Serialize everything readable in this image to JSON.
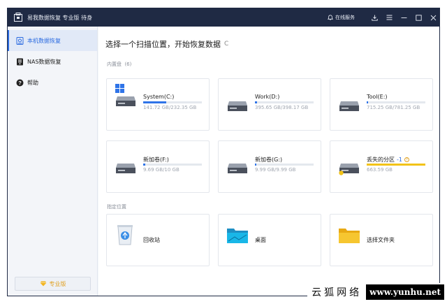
{
  "app": {
    "title": "易我数据恢复 专业版 待身",
    "online_service": "在线服务"
  },
  "sidebar": {
    "items": [
      {
        "label": "本机数据恢复",
        "icon": "computer-recovery-icon",
        "active": true
      },
      {
        "label": "NAS数据恢复",
        "icon": "nas-icon",
        "active": false
      },
      {
        "label": "帮助",
        "icon": "help-icon",
        "active": false
      }
    ],
    "pro_label": "专业版"
  },
  "main": {
    "heading": "选择一个扫描位置，开始恢复数据",
    "refresh_symbol": "C",
    "internal_label": "内置盘",
    "internal_count": "(6)",
    "drives": [
      {
        "name": "System(C:)",
        "size": "141.72 GB/232.35 GB",
        "used_fraction": 0.39,
        "icon": "windows-drive-icon"
      },
      {
        "name": "Work(D:)",
        "size": "395.65 GB/398.17 GB",
        "used_fraction": 0.02,
        "icon": "drive-icon"
      },
      {
        "name": "Tool(E:)",
        "size": "715.25 GB/781.25 GB",
        "used_fraction": 0.01,
        "icon": "drive-icon"
      },
      {
        "name": "新加卷(F:)",
        "size": "9.69 GB/10 GB",
        "used_fraction": 0.03,
        "icon": "drive-icon"
      },
      {
        "name": "新加卷(G:)",
        "size": "9.99 GB/9.99 GB",
        "used_fraction": 0.01,
        "icon": "drive-icon"
      },
      {
        "name": "丢失的分区",
        "extra": "-1",
        "size": "663.59 GB",
        "used_fraction": 1.0,
        "icon": "lost-drive-icon"
      }
    ],
    "location_label": "指定位置",
    "locations": [
      {
        "name": "回收站",
        "icon": "recycle-bin-icon"
      },
      {
        "name": "桌面",
        "icon": "desktop-icon"
      },
      {
        "name": "选择文件夹",
        "icon": "folder-icon"
      }
    ]
  },
  "watermark": {
    "cn": "云狐网络",
    "url": "www.yunhu.net"
  },
  "colors": {
    "titlebar": "#1f2a44",
    "accent": "#2a6ae0",
    "bar_blue": "#2f74e8",
    "bar_yellow": "#f2c318"
  }
}
